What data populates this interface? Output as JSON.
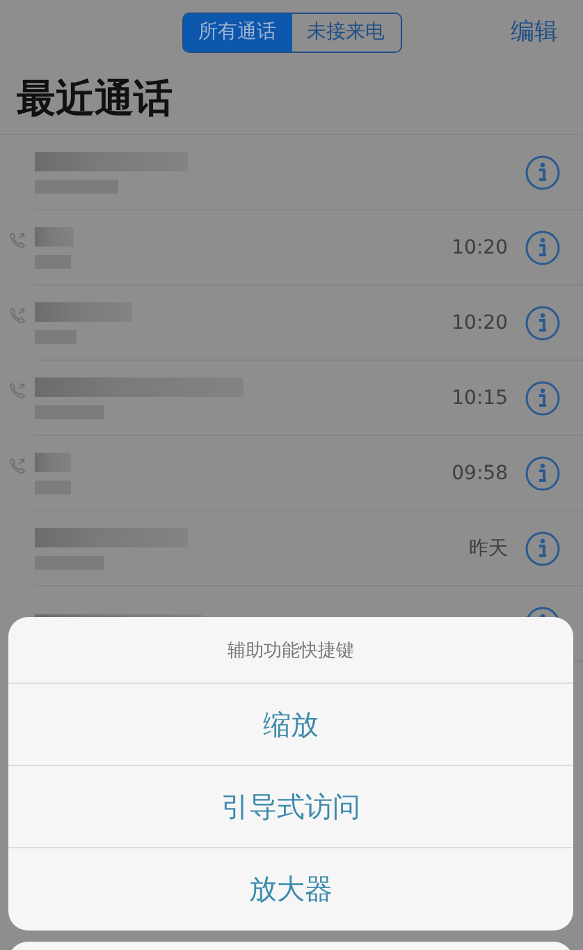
{
  "segments": [
    {
      "label": "所有通话",
      "selected": true
    },
    {
      "label": "未接来电",
      "selected": false
    }
  ],
  "edit_button": "编辑",
  "title": "最近通话",
  "calls": [
    {
      "outgoing": false
    },
    {
      "outgoing": true,
      "time": "10:20"
    },
    {
      "outgoing": true,
      "time": "10:20"
    },
    {
      "outgoing": true,
      "time": "10:15"
    },
    {
      "outgoing": true,
      "time": "09:58"
    },
    {
      "outgoing": false,
      "time": "昨天"
    },
    {
      "outgoing": false
    }
  ],
  "action_sheet": {
    "title": "辅助功能快捷键",
    "options": [
      "缩放",
      "引导式访问",
      "放大器"
    ]
  }
}
